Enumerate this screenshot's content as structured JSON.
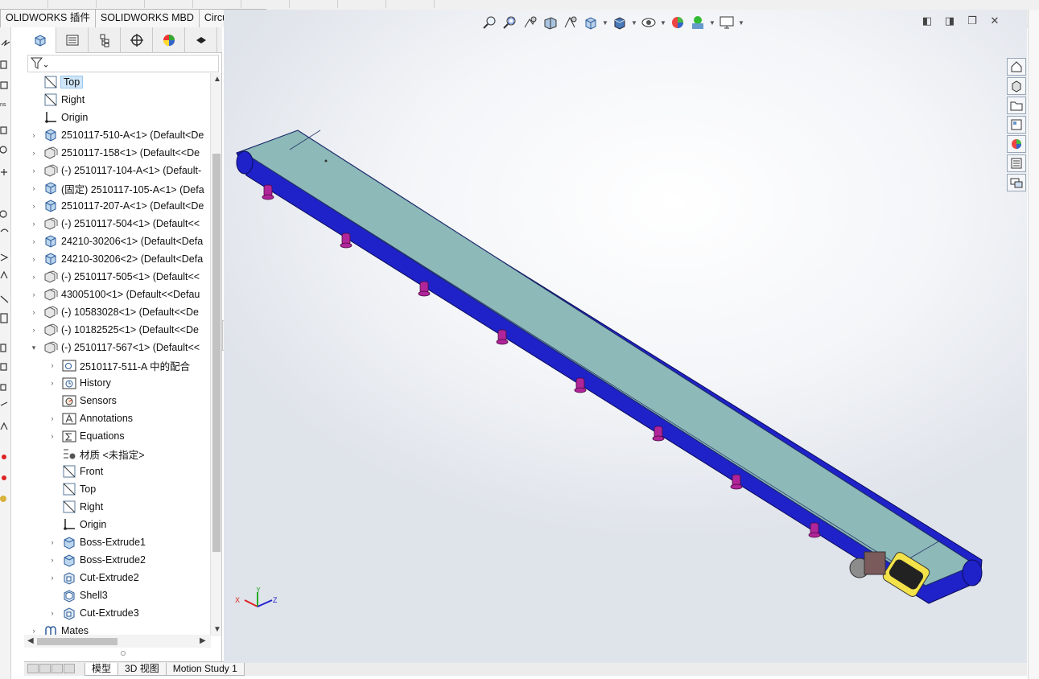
{
  "ribbon": {
    "tabs": [
      "OLIDWORKS 插件",
      "SOLIDWORKS MBD",
      "CircuitWorks"
    ]
  },
  "feature_manager": {
    "tab_icons": [
      "feature-manager-icon",
      "property-manager-icon",
      "configuration-manager-icon",
      "dimxpert-icon",
      "display-manager-icon",
      "cam-icon"
    ],
    "tree": [
      {
        "label": "Top",
        "icon": "plane-icon",
        "level": 0,
        "expandable": false,
        "selected": true
      },
      {
        "label": "Right",
        "icon": "plane-icon",
        "level": 0,
        "expandable": false
      },
      {
        "label": "Origin",
        "icon": "origin-icon",
        "level": 0,
        "expandable": false
      },
      {
        "label": "2510117-510-A<1> (Default<De",
        "icon": "part-icon",
        "level": 0,
        "expandable": true
      },
      {
        "label": "2510117-158<1> (Default<<De",
        "icon": "subassembly-icon",
        "level": 0,
        "expandable": true
      },
      {
        "label": "(-) 2510117-104-A<1> (Default-",
        "icon": "subassembly-icon",
        "level": 0,
        "expandable": true
      },
      {
        "label": "(固定) 2510117-105-A<1> (Defa",
        "icon": "part-icon",
        "level": 0,
        "expandable": true
      },
      {
        "label": "2510117-207-A<1> (Default<De",
        "icon": "part-icon",
        "level": 0,
        "expandable": true
      },
      {
        "label": "(-) 2510117-504<1> (Default<<",
        "icon": "subassembly-icon",
        "level": 0,
        "expandable": true
      },
      {
        "label": "24210-30206<1> (Default<Defa",
        "icon": "part-icon",
        "level": 0,
        "expandable": true
      },
      {
        "label": "24210-30206<2> (Default<Defa",
        "icon": "part-icon",
        "level": 0,
        "expandable": true
      },
      {
        "label": "(-) 2510117-505<1> (Default<<",
        "icon": "subassembly-icon",
        "level": 0,
        "expandable": true
      },
      {
        "label": "43005100<1> (Default<<Defau",
        "icon": "subassembly-icon",
        "level": 0,
        "expandable": true
      },
      {
        "label": "(-) 10583028<1> (Default<<De",
        "icon": "subassembly-icon",
        "level": 0,
        "expandable": true
      },
      {
        "label": "(-) 10182525<1> (Default<<De",
        "icon": "subassembly-icon",
        "level": 0,
        "expandable": true
      },
      {
        "label": "(-) 2510117-567<1> (Default<<",
        "icon": "subassembly-icon",
        "level": 0,
        "expandable": true,
        "expanded": true
      },
      {
        "label": "2510117-511-A 中的配合",
        "icon": "mates-folder-icon",
        "level": 1,
        "expandable": true
      },
      {
        "label": "History",
        "icon": "history-icon",
        "level": 1,
        "expandable": true
      },
      {
        "label": "Sensors",
        "icon": "sensor-icon",
        "level": 1,
        "expandable": false
      },
      {
        "label": "Annotations",
        "icon": "annotations-icon",
        "level": 1,
        "expandable": true
      },
      {
        "label": "Equations",
        "icon": "equations-icon",
        "level": 1,
        "expandable": true
      },
      {
        "label": "材质 <未指定>",
        "icon": "material-icon",
        "level": 1,
        "expandable": false
      },
      {
        "label": "Front",
        "icon": "plane-icon",
        "level": 1,
        "expandable": false
      },
      {
        "label": "Top",
        "icon": "plane-icon",
        "level": 1,
        "expandable": false
      },
      {
        "label": "Right",
        "icon": "plane-icon",
        "level": 1,
        "expandable": false
      },
      {
        "label": "Origin",
        "icon": "origin-icon",
        "level": 1,
        "expandable": false
      },
      {
        "label": "Boss-Extrude1",
        "icon": "extrude-icon",
        "level": 1,
        "expandable": true
      },
      {
        "label": "Boss-Extrude2",
        "icon": "extrude-icon",
        "level": 1,
        "expandable": true
      },
      {
        "label": "Cut-Extrude2",
        "icon": "cut-extrude-icon",
        "level": 1,
        "expandable": true
      },
      {
        "label": "Shell3",
        "icon": "shell-icon",
        "level": 1,
        "expandable": false
      },
      {
        "label": "Cut-Extrude3",
        "icon": "cut-extrude-icon",
        "level": 1,
        "expandable": true
      },
      {
        "label": "Mates",
        "icon": "mates-icon",
        "level": 0,
        "expandable": true
      }
    ]
  },
  "bottom_tabs": [
    "模型",
    "3D 视图",
    "Motion Study 1"
  ],
  "heads_up_toolbar": [
    "zoom-to-fit-icon",
    "zoom-to-area-icon",
    "previous-view-icon",
    "section-view-icon",
    "dynamic-annotation-icon",
    "view-orientation-icon",
    "display-style-icon",
    "hide-show-icon",
    "edit-appearance-icon",
    "apply-scene-icon",
    "view-settings-icon"
  ],
  "task_pane": [
    "home-icon",
    "design-library-icon",
    "file-explorer-icon",
    "view-palette-icon",
    "appearances-icon",
    "custom-properties-icon",
    "forum-icon"
  ],
  "colors": {
    "belt": "#8db9b9",
    "frame": "#1f22c8",
    "feet": "#b0259a",
    "selection": "#cfe5f8"
  },
  "triad": {
    "x": "X",
    "y": "Y",
    "z": "Z"
  }
}
